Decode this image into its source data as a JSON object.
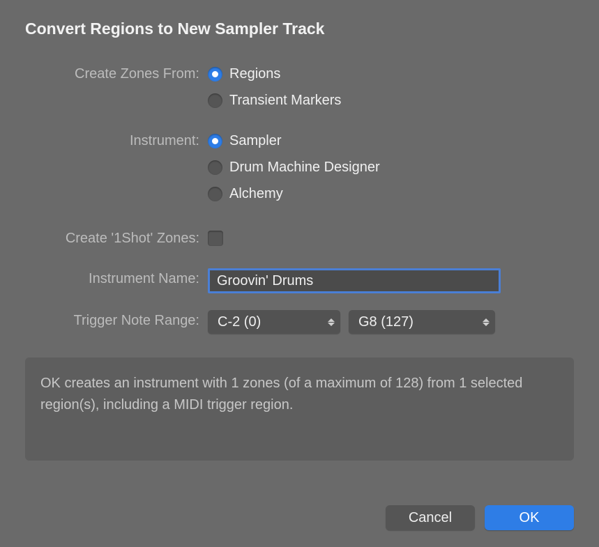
{
  "title": "Convert Regions to New Sampler Track",
  "labels": {
    "createZones": "Create Zones From:",
    "instrument": "Instrument:",
    "oneShot": "Create '1Shot' Zones:",
    "instrumentName": "Instrument Name:",
    "triggerRange": "Trigger Note Range:"
  },
  "createZones": {
    "options": [
      {
        "label": "Regions",
        "selected": true
      },
      {
        "label": "Transient Markers",
        "selected": false
      }
    ]
  },
  "instrument": {
    "options": [
      {
        "label": "Sampler",
        "selected": true
      },
      {
        "label": "Drum Machine Designer",
        "selected": false
      },
      {
        "label": "Alchemy",
        "selected": false
      }
    ]
  },
  "oneShot": {
    "checked": false
  },
  "instrumentName": {
    "value": "Groovin' Drums"
  },
  "triggerRange": {
    "low": "C-2  (0)",
    "high": "G8   (127)"
  },
  "info": "OK creates an instrument with 1 zones (of a maximum of 128) from 1 selected region(s), including a MIDI trigger region.",
  "buttons": {
    "cancel": "Cancel",
    "ok": "OK"
  }
}
